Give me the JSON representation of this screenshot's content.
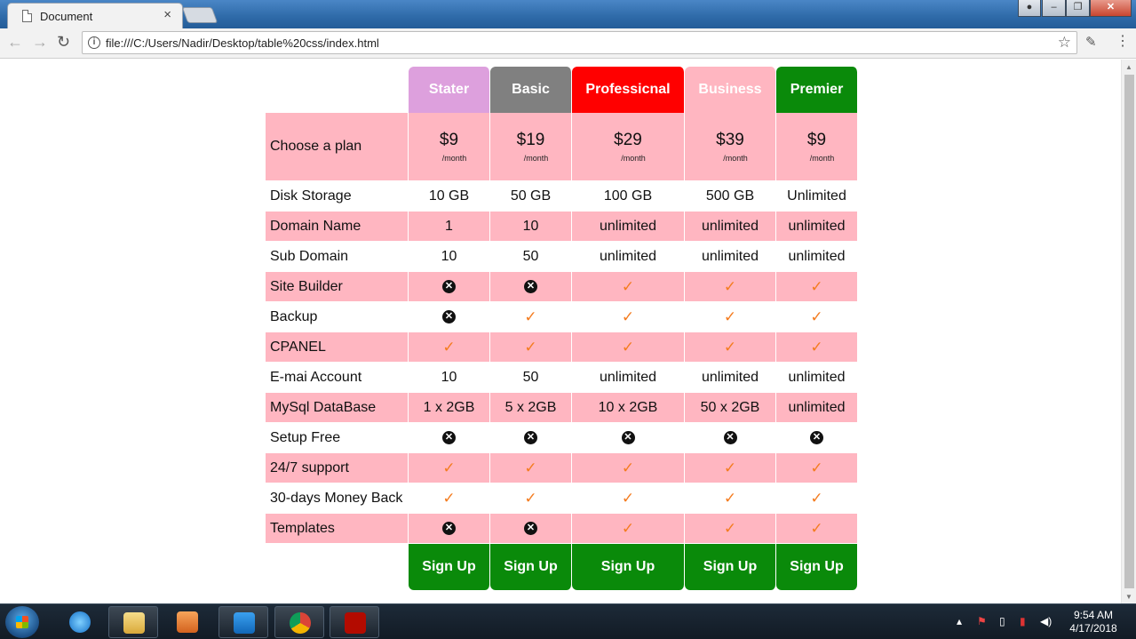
{
  "browser": {
    "tab_title": "Document",
    "url": "file:///C:/Users/Nadir/Desktop/table%20css/index.html"
  },
  "pricing": {
    "plans": [
      {
        "name": "Stater",
        "color": "#dda0dd",
        "price": "$9"
      },
      {
        "name": "Basic",
        "color": "#808080",
        "price": "$19"
      },
      {
        "name": "Professicnal",
        "color": "#ff0000",
        "price": "$29"
      },
      {
        "name": "Business",
        "color": "#ffb6c1",
        "price": "$39"
      },
      {
        "name": "Premier",
        "color": "#0a8a0a",
        "price": "$9"
      }
    ],
    "choose_label": "Choose a plan",
    "per_month": "/month",
    "signup_label": "Sign Up",
    "features": [
      {
        "label": "Disk Storage",
        "values": [
          "10 GB",
          "50 GB",
          "100 GB",
          "500 GB",
          "Unlimited"
        ]
      },
      {
        "label": "Domain Name",
        "values": [
          "1",
          "10",
          "unlimited",
          "unlimited",
          "unlimited"
        ]
      },
      {
        "label": "Sub Domain",
        "values": [
          "10",
          "50",
          "unlimited",
          "unlimited",
          "unlimited"
        ]
      },
      {
        "label": "Site Builder",
        "values": [
          "x-icon",
          "x-icon",
          "check-icon",
          "check-icon",
          "check-icon"
        ]
      },
      {
        "label": "Backup",
        "values": [
          "x-icon",
          "check-icon",
          "check-icon",
          "check-icon",
          "check-icon"
        ]
      },
      {
        "label": "CPANEL",
        "values": [
          "check-icon",
          "check-icon",
          "check-icon",
          "check-icon",
          "check-icon"
        ]
      },
      {
        "label": "E-mai Account",
        "values": [
          "10",
          "50",
          "unlimited",
          "unlimited",
          "unlimited"
        ]
      },
      {
        "label": "MySql DataBase",
        "values": [
          "1 x 2GB",
          "5 x 2GB",
          "10 x 2GB",
          "50 x 2GB",
          "unlimited"
        ]
      },
      {
        "label": "Setup Free",
        "values": [
          "x-icon",
          "x-icon",
          "x-icon",
          "x-icon",
          "x-icon"
        ]
      },
      {
        "label": "24/7 support",
        "values": [
          "check-icon",
          "check-icon",
          "check-icon",
          "check-icon",
          "check-icon"
        ]
      },
      {
        "label": "30-days Money Back",
        "values": [
          "check-icon",
          "check-icon",
          "check-icon",
          "check-icon",
          "check-icon"
        ]
      },
      {
        "label": "Templates",
        "values": [
          "x-icon",
          "x-icon",
          "check-icon",
          "check-icon",
          "check-icon"
        ]
      }
    ]
  },
  "taskbar": {
    "apps": [
      "internet-explorer-icon",
      "file-explorer-icon",
      "media-player-icon",
      "visual-studio-code-icon",
      "chrome-icon",
      "acrobat-icon"
    ],
    "time": "9:54 AM",
    "date": "4/17/2018"
  }
}
